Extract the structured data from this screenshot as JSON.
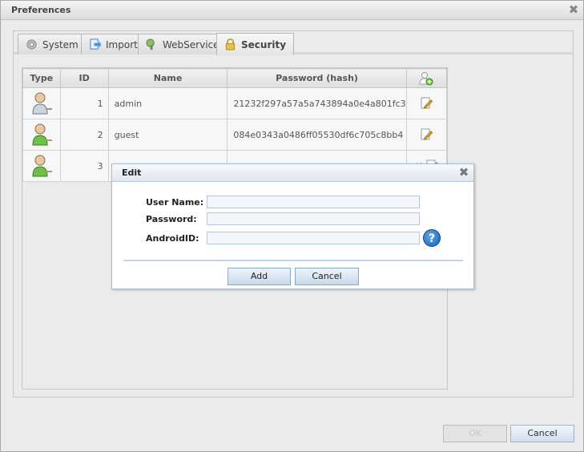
{
  "window": {
    "title": "Preferences",
    "close_icon": "close-icon"
  },
  "tabs": [
    {
      "label": "System",
      "icon": "gear-icon",
      "active": false
    },
    {
      "label": "Import",
      "icon": "import-icon",
      "active": false
    },
    {
      "label": "WebService",
      "icon": "webservice-icon",
      "active": false
    },
    {
      "label": "Security",
      "icon": "lock-icon",
      "active": true
    }
  ],
  "table": {
    "headers": {
      "type": "Type",
      "id": "ID",
      "name": "Name",
      "password": "Password (hash)",
      "action_icon": "add-user-icon"
    },
    "rows": [
      {
        "type_icon": "admin-user-icon",
        "id": "1",
        "name": "admin",
        "password": "21232f297a57a5a743894a0e4a801fc3",
        "actions": [
          "edit-icon"
        ]
      },
      {
        "type_icon": "user-icon",
        "id": "2",
        "name": "guest",
        "password": "084e0343a0486ff05530df6c705c8bb4",
        "actions": [
          "edit-icon"
        ]
      },
      {
        "type_icon": "user-icon",
        "id": "3",
        "name": "",
        "password": "",
        "actions": [
          "delete-icon",
          "edit-icon"
        ]
      }
    ]
  },
  "dialog": {
    "title": "Edit",
    "username_label": "User Name:",
    "password_label": "Password:",
    "androidid_label": "AndroidID:",
    "username_value": "",
    "password_value": "",
    "androidid_value": "",
    "help_icon": "help-icon",
    "help_glyph": "?",
    "add_label": "Add",
    "cancel_label": "Cancel"
  },
  "footer": {
    "ok_label": "OK",
    "cancel_label": "Cancel"
  },
  "colors": {
    "accent": "#cfd8e3",
    "help_blue": "#1a5fa8",
    "delete_red": "#d33"
  }
}
